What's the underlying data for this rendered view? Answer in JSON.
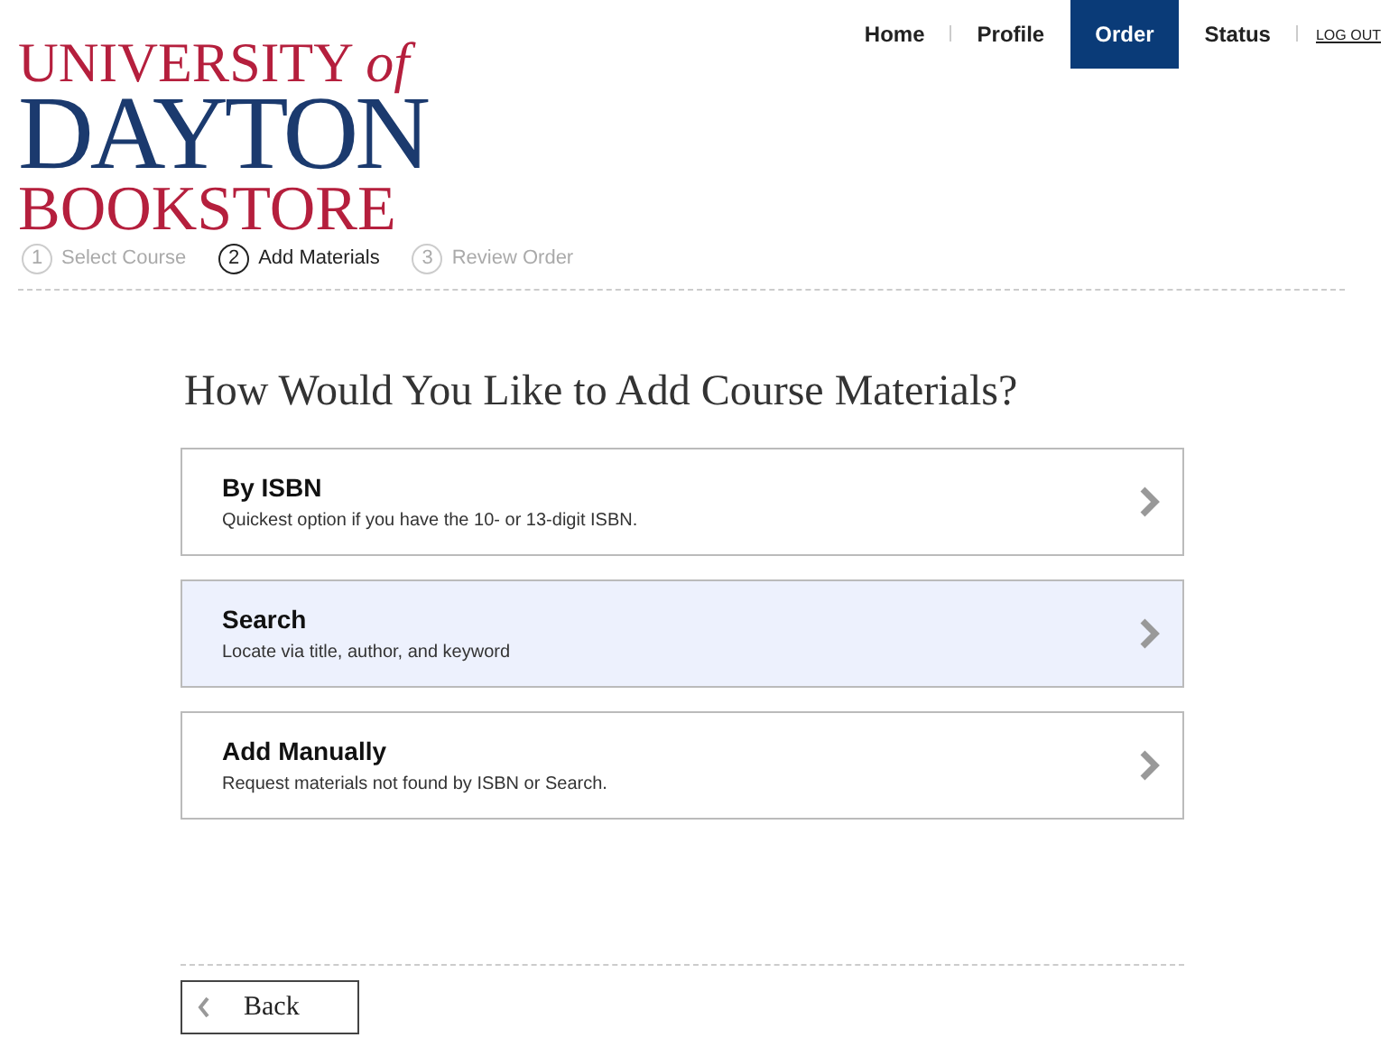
{
  "logo": {
    "lines": [
      "UNIVERSITY *of*",
      "DAYTON",
      "BOOKSTORE"
    ]
  },
  "nav": [
    {
      "label": "Home",
      "selected": false
    },
    {
      "label": "Profile",
      "selected": false
    },
    {
      "label": "Order",
      "selected": true
    },
    {
      "label": "Status",
      "selected": false
    }
  ],
  "logout": "LOG OUT",
  "steps": [
    {
      "number": "1",
      "label": "Select Course",
      "selected": false
    },
    {
      "number": "2",
      "label": "Add Materials",
      "selected": true
    },
    {
      "number": "3",
      "label": "Review Order",
      "selected": false
    }
  ],
  "heading": "How Would You Like to Add Course Materials?",
  "options": [
    {
      "title": "By ISBN",
      "description": "Quickest option if you have the 10- or 13-digit ISBN.",
      "selected": false
    },
    {
      "title": "Search",
      "description": "Locate via title, author, and keyword",
      "selected": true
    },
    {
      "title": "Add Manually",
      "description": "Request materials not found by ISBN or Search.",
      "selected": false
    }
  ],
  "back_button": "Back"
}
